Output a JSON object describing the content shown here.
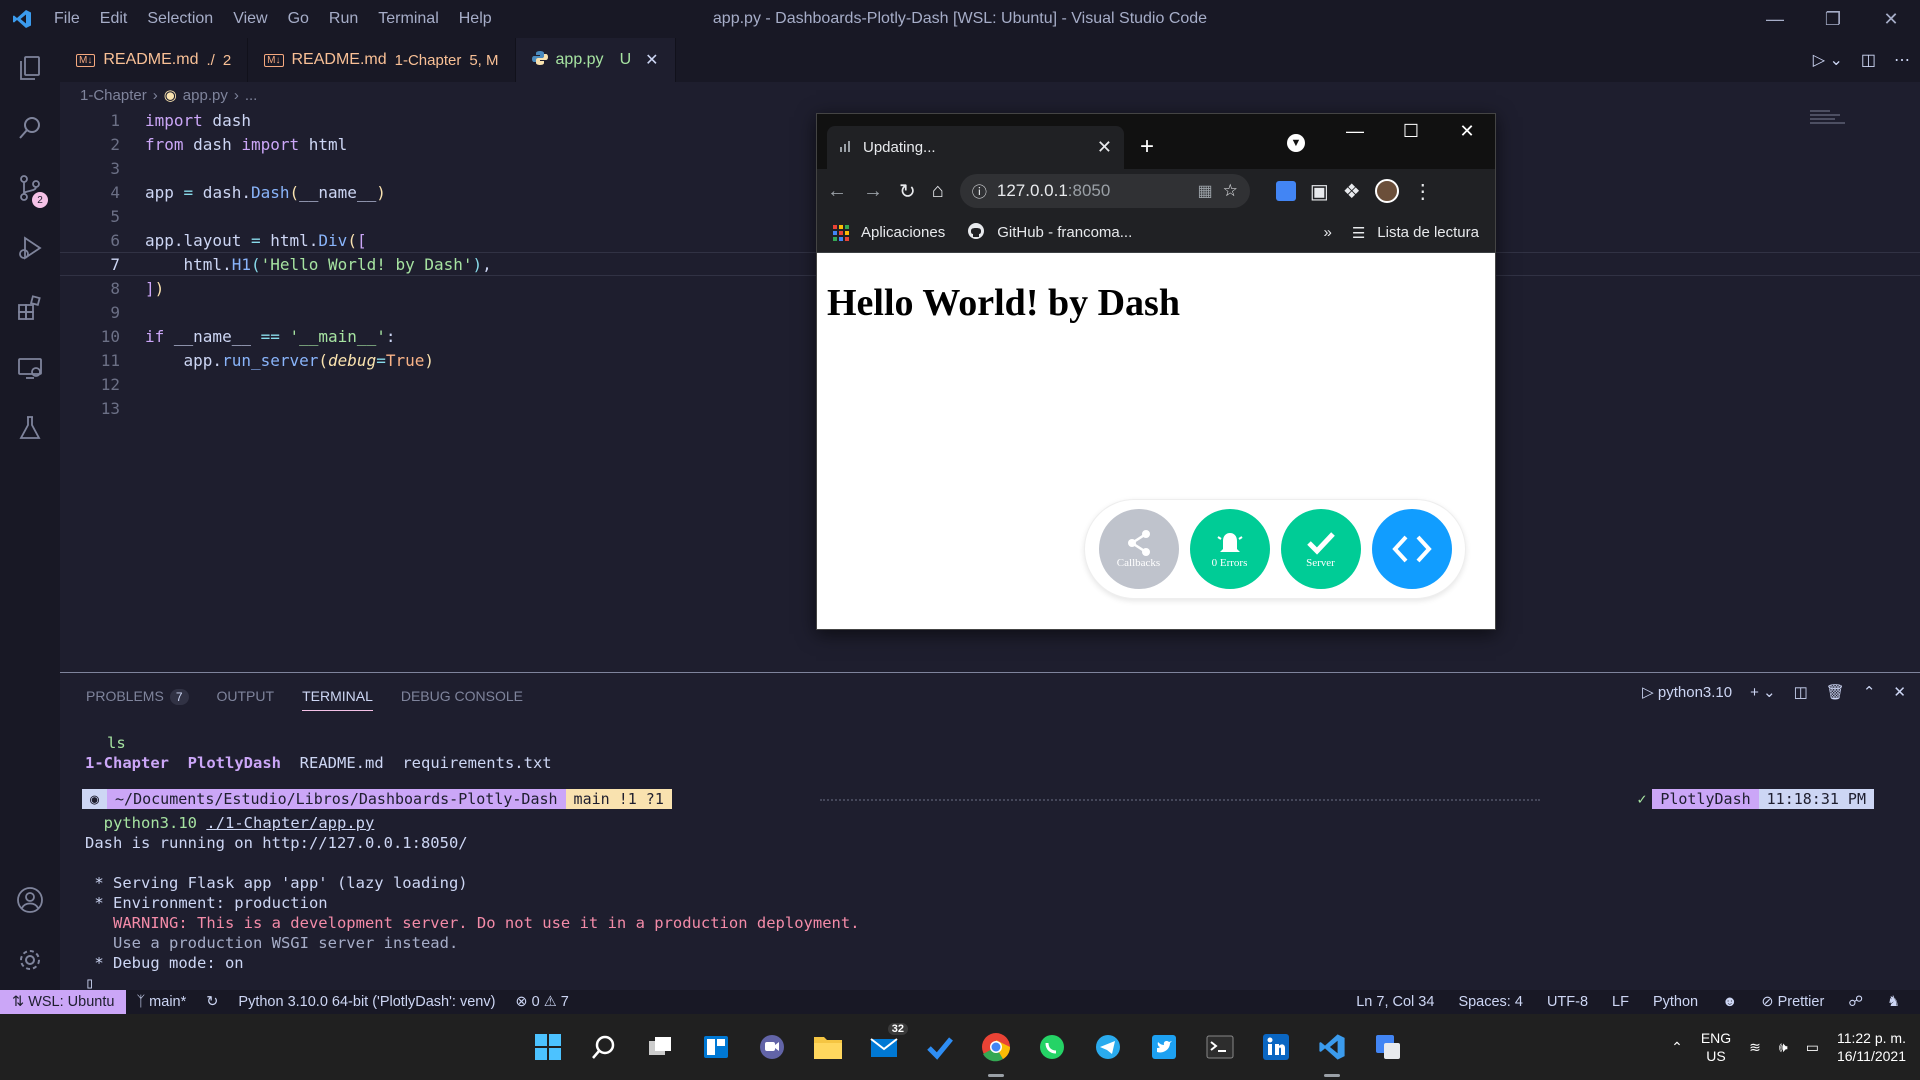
{
  "titlebar": {
    "menu": [
      "File",
      "Edit",
      "Selection",
      "View",
      "Go",
      "Run",
      "Terminal",
      "Help"
    ],
    "title": "app.py - Dashboards-Plotly-Dash [WSL: Ubuntu] - Visual Studio Code"
  },
  "activity": {
    "scm_badge": "2"
  },
  "tabs": [
    {
      "name": "README.md",
      "sub": "./",
      "flag": "2"
    },
    {
      "name": "README.md",
      "sub": "1-Chapter",
      "flag": "5, M"
    },
    {
      "name": "app.py",
      "sub": "",
      "flag": "U"
    }
  ],
  "breadcrumb": {
    "folder": "1-Chapter",
    "file": "app.py",
    "rest": "..."
  },
  "editor": {
    "line_numbers": [
      "1",
      "2",
      "3",
      "4",
      "5",
      "6",
      "7",
      "8",
      "9",
      "10",
      "11",
      "12",
      "13"
    ]
  },
  "browser": {
    "tab_title": "Updating...",
    "url_host": "127.0.0.1",
    "url_port": ":8050",
    "bookmarks": {
      "apps": "Aplicaciones",
      "github": "GitHub - francoma...",
      "more": "»",
      "reading": "Lista de lectura"
    },
    "heading": "Hello World! by Dash",
    "dash_buttons": [
      {
        "label": "Callbacks",
        "color": "#bfc3cc"
      },
      {
        "label": "0 Errors",
        "color": "#00cc96"
      },
      {
        "label": "Server",
        "color": "#00cc96"
      },
      {
        "label": "",
        "color": "#119dff"
      }
    ]
  },
  "panel": {
    "tabs": [
      "PROBLEMS",
      "OUTPUT",
      "TERMINAL",
      "DEBUG CONSOLE"
    ],
    "problems_count": "7",
    "terminal_name": "python3.10",
    "terminal": {
      "ls_cmd": "ls",
      "ls_dir1": "1-Chapter",
      "ls_dir2": "PlotlyDash",
      "ls_files": "README.md  requirements.txt",
      "prompt_path": "~/Documents/Estudio/Libros/Dashboards-Plotly-Dash",
      "prompt_git": "main !1 ?1",
      "prompt_env": "PlotlyDash",
      "prompt_time": "11:18:31 PM",
      "run_cmd_a": "python3.10",
      "run_cmd_b": "./1-Chapter/app.py",
      "out1": "Dash is running on http://127.0.0.1:8050/",
      "out2": " * Serving Flask app 'app' (lazy loading)",
      "out3": " * Environment: production",
      "out4": "   WARNING: This is a development server. Do not use it in a production deployment.",
      "out5": "   Use a production WSGI server instead.",
      "out6": " * Debug mode: on"
    }
  },
  "status": {
    "remote": "WSL: Ubuntu",
    "branch": "main*",
    "python": "Python 3.10.0 64-bit ('PlotlyDash': venv)",
    "errors": "0",
    "warnings": "7",
    "position": "Ln 7, Col 34",
    "spaces": "Spaces: 4",
    "encoding": "UTF-8",
    "eol": "LF",
    "language": "Python",
    "prettier": "Prettier"
  },
  "taskbar": {
    "mail_badge": "32",
    "lang_top": "ENG",
    "lang_bottom": "US",
    "time": "11:22 p. m.",
    "date": "16/11/2021"
  }
}
